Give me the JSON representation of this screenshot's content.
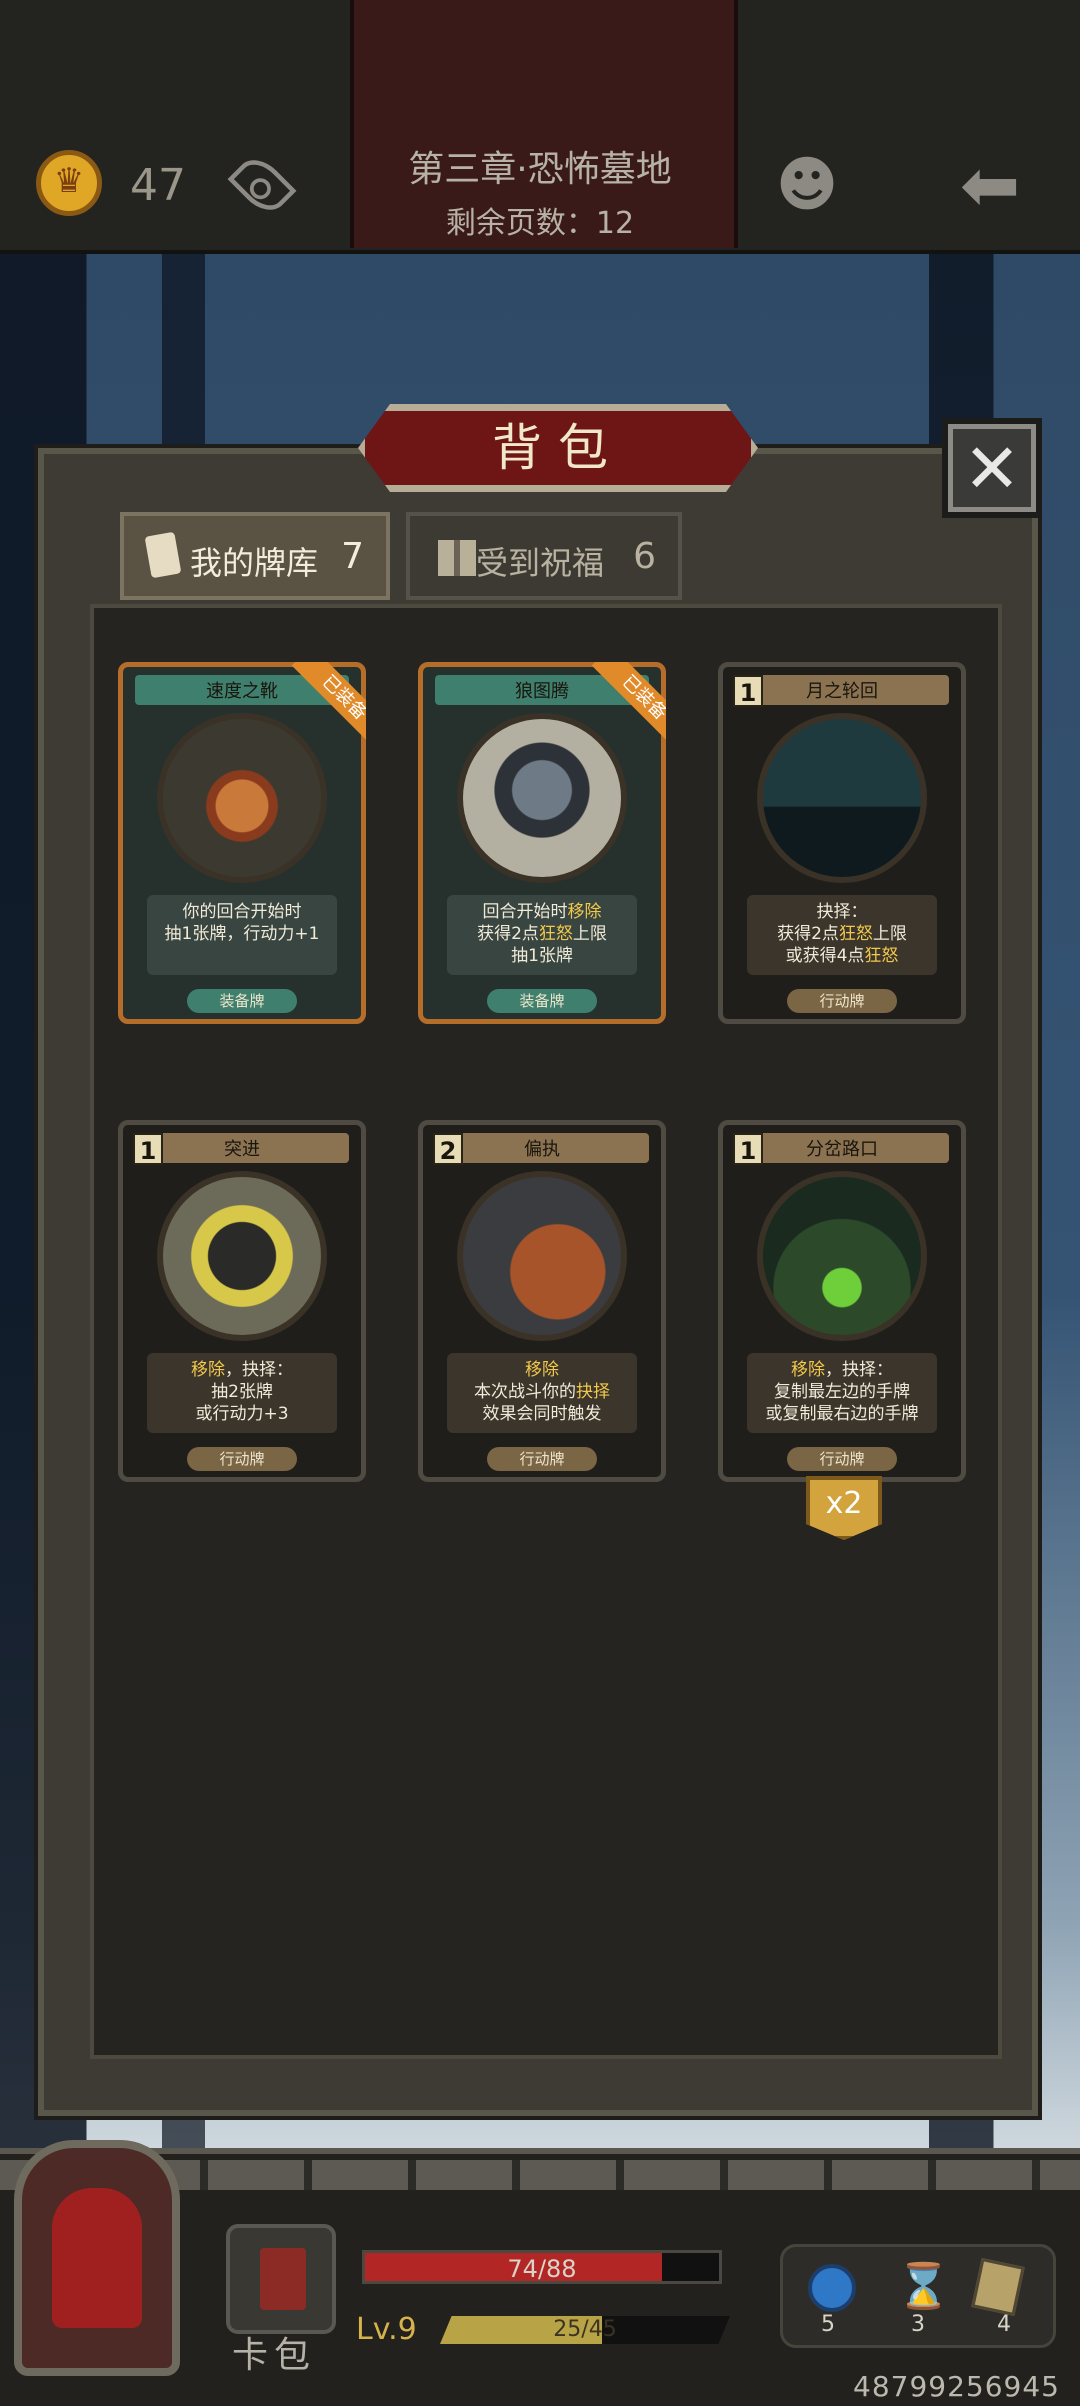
{
  "header": {
    "coins": "47",
    "chapter_title": "第三章·恐怖墓地",
    "pages_left": "剩余页数：12"
  },
  "dialog": {
    "title": "背包",
    "close_label": "✕",
    "tabs": [
      {
        "label": "我的牌库",
        "count": "7"
      },
      {
        "label": "受到祝福",
        "count": "6"
      }
    ]
  },
  "cards": [
    {
      "name": "速度之靴",
      "cost": "",
      "equipped_label": "已装备",
      "desc_lines": [
        "你的回合开始时",
        "抽1张牌，行动力+1"
      ],
      "type": "装备牌"
    },
    {
      "name": "狼图腾",
      "cost": "",
      "equipped_label": "已装备",
      "desc_lines": [
        "回合开始时移除",
        "获得2点狂怒上限",
        "抽1张牌"
      ],
      "type": "装备牌"
    },
    {
      "name": "月之轮回",
      "cost": "1",
      "equipped_label": "",
      "desc_lines": [
        "抉择：",
        "获得2点狂怒上限",
        "或获得4点狂怒"
      ],
      "type": "行动牌"
    },
    {
      "name": "突进",
      "cost": "1",
      "equipped_label": "",
      "desc_lines": [
        "移除，抉择：",
        "抽2张牌",
        "或行动力+3"
      ],
      "type": "行动牌"
    },
    {
      "name": "偏执",
      "cost": "2",
      "equipped_label": "",
      "desc_lines": [
        "移除",
        "本次战斗你的抉择",
        "效果会同时触发"
      ],
      "type": "行动牌"
    },
    {
      "name": "分岔路口",
      "cost": "1",
      "equipped_label": "",
      "desc_lines": [
        "移除，抉择：",
        "复制最左边的手牌",
        "或复制最右边的手牌"
      ],
      "type": "行动牌"
    }
  ],
  "multiplier": "x2",
  "hud": {
    "cardpack_label": "卡包",
    "hp_text": "74/88",
    "hp_fraction": 0.84,
    "level": "Lv.9",
    "xp_text": "25/45",
    "xp_fraction": 0.56,
    "items": [
      {
        "icon": "potion-icon",
        "count": "5"
      },
      {
        "icon": "hourglass-icon",
        "count": "3"
      },
      {
        "icon": "cards-icon",
        "count": "4"
      }
    ]
  },
  "footer_id": "48799256945",
  "colors": {
    "accent_gold": "#f2c94c",
    "equip_teal": "#3f7f6e",
    "hp_red": "#b32626"
  }
}
